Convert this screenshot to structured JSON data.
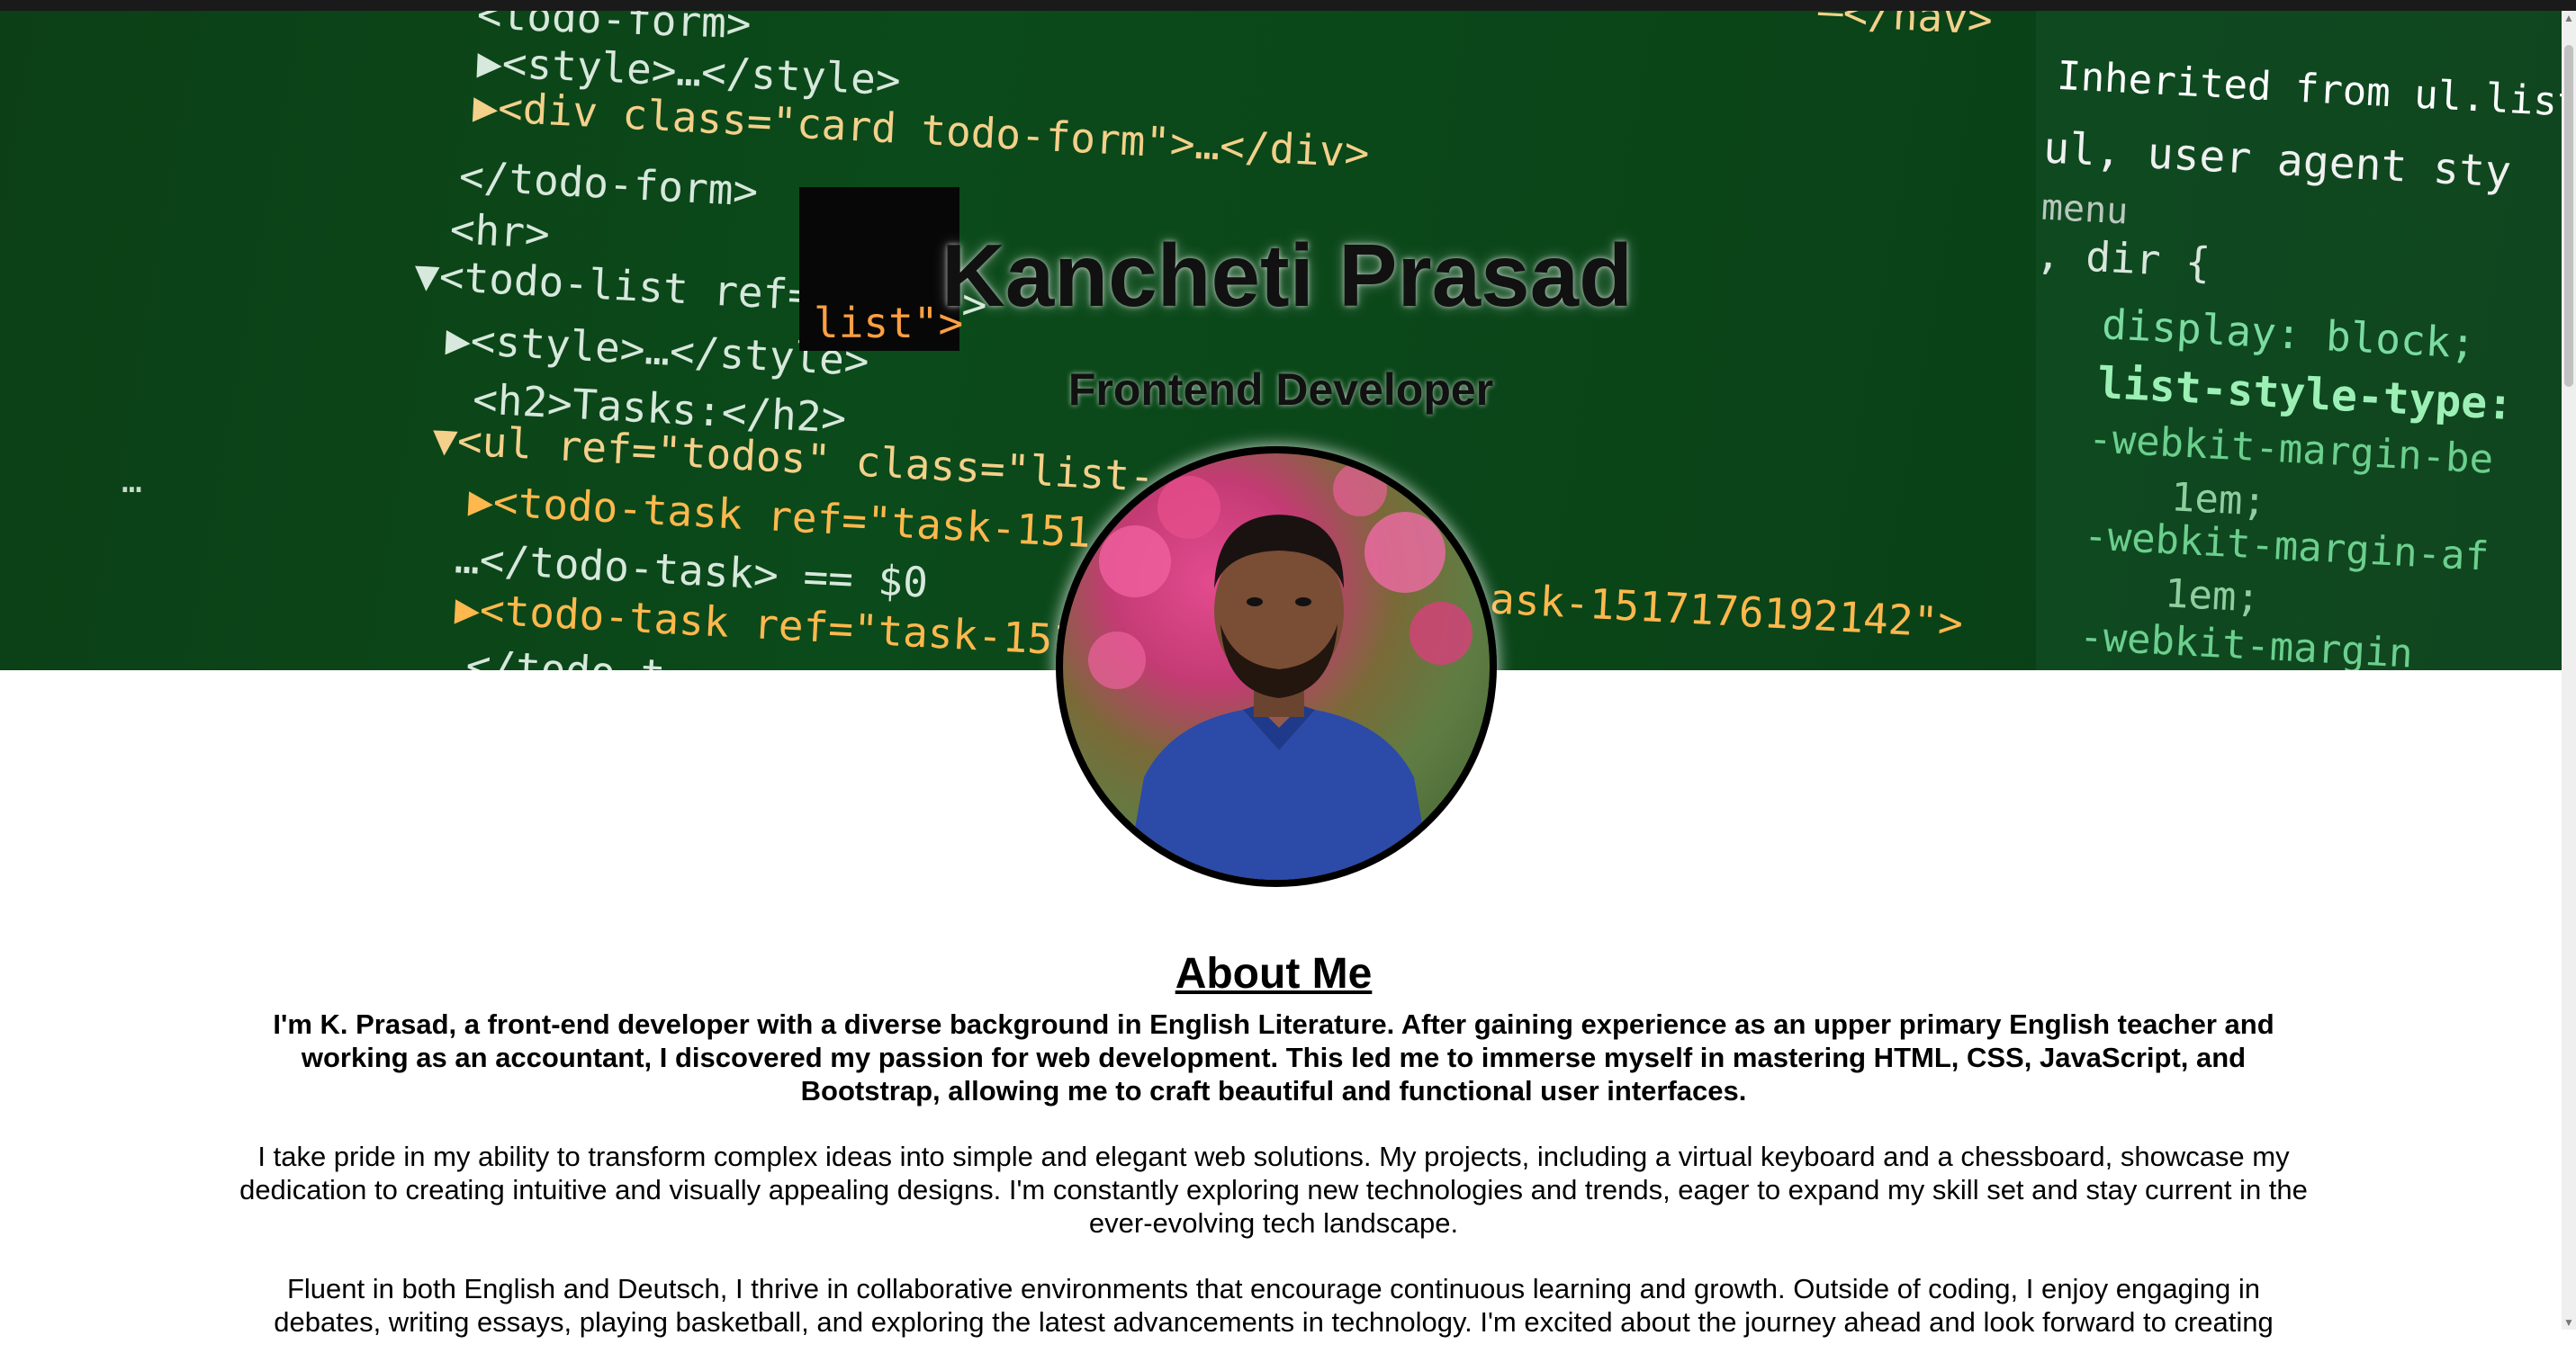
{
  "hero": {
    "name": "Kancheti Prasad",
    "role": "Frontend Developer",
    "avatar_alt": "Profile photo of Kancheti Prasad",
    "accent_colors": {
      "background": "#0b4a1a",
      "code_tags": "#8fd3ff",
      "code_attrs": "#f4d08a",
      "code_strings": "#ffb84d"
    },
    "code_lines": [
      "<todo-form>",
      "▶<style>…</style>",
      "▶<div class=\"card todo-form\">…</div>",
      "</todo-form>",
      "<hr>",
      "▼<todo-list ref=\"list\">",
      "▶<style>…</style>",
      "<h2>Tasks:</h2>",
      "▼<ul ref=\"todos\" class=\"list-",
      "▶<todo-task ref=\"task-151",
      "…</todo-task> == $0",
      "▶<todo-task ref=\"task-151",
      "…</todo-t"
    ],
    "right_pane_lines": [
      "Inherited from ul.list",
      "ul,  user agent sty",
      "menu",
      ", dir {",
      "display: block;",
      "list-style-type:",
      "-webkit-margin-be",
      "1em;",
      "-webkit-margin-af",
      "1em;",
      "-webkit-margin"
    ],
    "square_text": "list\">",
    "fragment_task": "ask-1517176192142\">",
    "fragment_nav": "—</nav>",
    "ellipsis": "…"
  },
  "about": {
    "heading": "About Me",
    "paragraphs": [
      "I'm K. Prasad, a front-end developer with a diverse background in English Literature. After gaining experience as an upper primary English teacher and working as an accountant, I discovered my passion for web development. This led me to immerse myself in mastering HTML, CSS, JavaScript, and Bootstrap, allowing me to craft beautiful and functional user interfaces.",
      "I take pride in my ability to transform complex ideas into simple and elegant web solutions. My projects, including a virtual keyboard and a chessboard, showcase my dedication to creating intuitive and visually appealing designs. I'm constantly exploring new technologies and trends, eager to expand my skill set and stay current in the ever-evolving tech landscape.",
      "Fluent in both English and Deutsch, I thrive in collaborative environments that encourage continuous learning and growth. Outside of coding, I enjoy engaging in debates, writing essays, playing basketball, and exploring the latest advancements in technology. I'm excited about the journey ahead and look forward to creating"
    ]
  },
  "scrollbar": {
    "up_icon": "▲",
    "down_icon": "▼"
  }
}
